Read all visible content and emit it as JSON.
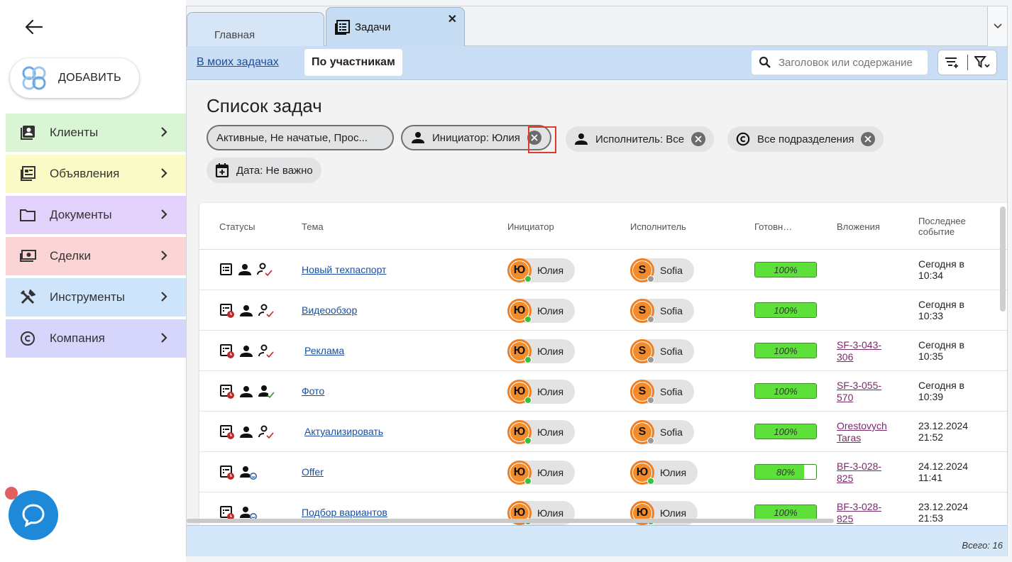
{
  "sidebar": {
    "add_label": "ДОБАВИТЬ",
    "items": [
      {
        "label": "Клиенты",
        "icon": "contacts-icon",
        "color": "#d9f5d3"
      },
      {
        "label": "Объявления",
        "icon": "listing-icon",
        "color": "#fbfbc8"
      },
      {
        "label": "Документы",
        "icon": "folder-icon",
        "color": "#e2d2fb"
      },
      {
        "label": "Сделки",
        "icon": "money-icon",
        "color": "#fbd5d5"
      },
      {
        "label": "Инструменты",
        "icon": "tools-icon",
        "color": "#cde4fb"
      },
      {
        "label": "Компания",
        "icon": "copyright-icon",
        "color": "#d6d5fb"
      }
    ]
  },
  "tabs": {
    "home": "Главная",
    "tasks": "Задачи"
  },
  "subbar": {
    "my_tasks": "В моих задачах",
    "by_participants": "По участникам",
    "search_placeholder": "Заголовок или содержание"
  },
  "page": {
    "title": "Список задач"
  },
  "filters": {
    "status": "Активные, Не начатые, Прос...",
    "initiator": "Инициатор: Юлия",
    "executor": "Исполнитель: Все",
    "departments": "Все подразделения",
    "date": "Дата: Не важно"
  },
  "table": {
    "headers": {
      "statuses": "Статусы",
      "topic": "Тема",
      "initiator": "Инициатор",
      "executor": "Исполнитель",
      "ready": "Готовн…",
      "attachments": "Вложения",
      "last_event_1": "Последнее",
      "last_event_2": "событие"
    },
    "rows": [
      {
        "topic": "Новый техпаспорт",
        "init_letter": "Ю",
        "init_name": "Юлия",
        "exec_letter": "S",
        "exec_name": "Sofia",
        "progress": 100,
        "progress_label": "100%",
        "attach_1": "",
        "attach_2": "",
        "event_1": "Сегодня в",
        "event_2": "10:34"
      },
      {
        "topic": "Видеообзор",
        "init_letter": "Ю",
        "init_name": "Юлия",
        "exec_letter": "S",
        "exec_name": "Sofia",
        "progress": 100,
        "progress_label": "100%",
        "attach_1": "",
        "attach_2": "",
        "event_1": "Сегодня в",
        "event_2": "10:33"
      },
      {
        "topic": "Реклама",
        "init_letter": "Ю",
        "init_name": "Юлия",
        "exec_letter": "S",
        "exec_name": "Sofia",
        "progress": 100,
        "progress_label": "100%",
        "attach_1": "SF-3-043-",
        "attach_2": "306",
        "event_1": "Сегодня в",
        "event_2": "10:35"
      },
      {
        "topic": "Фото",
        "init_letter": "Ю",
        "init_name": "Юлия",
        "exec_letter": "S",
        "exec_name": "Sofia",
        "progress": 100,
        "progress_label": "100%",
        "attach_1": "SF-3-055-",
        "attach_2": "570",
        "event_1": "Сегодня в",
        "event_2": "10:39"
      },
      {
        "topic": "Актуализировать",
        "init_letter": "Ю",
        "init_name": "Юлия",
        "exec_letter": "S",
        "exec_name": "Sofia",
        "progress": 100,
        "progress_label": "100%",
        "attach_1": "Orestovych",
        "attach_2": "Taras",
        "event_1": "23.12.2024",
        "event_2": "21:52"
      },
      {
        "topic": "Offer",
        "init_letter": "Ю",
        "init_name": "Юлия",
        "exec_letter": "Ю",
        "exec_name": "Юлия",
        "progress": 80,
        "progress_label": "80%",
        "attach_1": "BF-3-028-",
        "attach_2": "825",
        "event_1": "24.12.2024",
        "event_2": "11:41"
      },
      {
        "topic": "Подбор вариантов",
        "init_letter": "Ю",
        "init_name": "Юлия",
        "exec_letter": "Ю",
        "exec_name": "Юлия",
        "progress": 100,
        "progress_label": "100%",
        "attach_1": "BF-3-028-",
        "attach_2": "825",
        "event_1": "23.12.2024",
        "event_2": "21:53"
      }
    ]
  },
  "footer": {
    "total": "Всего: 16"
  }
}
